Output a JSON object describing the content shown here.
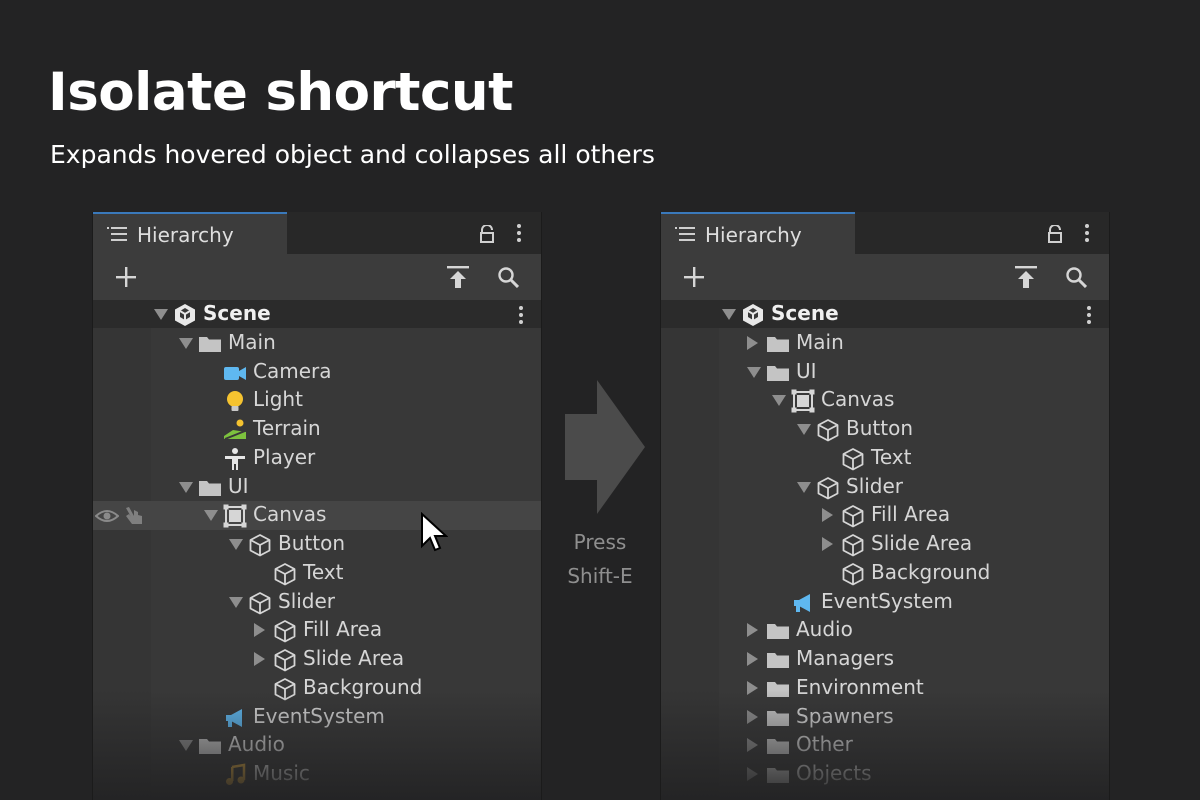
{
  "headline": "Isolate shortcut",
  "subline": "Expands hovered object and collapses all others",
  "arrow_text": {
    "line1": "Press",
    "line2": "Shift-E"
  },
  "panel_title": "Hierarchy",
  "colors": {
    "accent_tab": "#3a79bb",
    "folder": "#c4c4c4",
    "camera": "#5fb8f0",
    "light": "#f5c330",
    "terrain": "#7dc23e"
  },
  "left_tree": [
    {
      "label": "Scene",
      "depth": 0,
      "expander": "down",
      "icon": "unity-logo-icon",
      "bold": true
    },
    {
      "label": "Main",
      "depth": 1,
      "expander": "down",
      "icon": "folder-icon"
    },
    {
      "label": "Camera",
      "depth": 2,
      "expander": "none",
      "icon": "camera-icon"
    },
    {
      "label": "Light",
      "depth": 2,
      "expander": "none",
      "icon": "light-bulb-icon"
    },
    {
      "label": "Terrain",
      "depth": 2,
      "expander": "none",
      "icon": "terrain-icon"
    },
    {
      "label": "Player",
      "depth": 2,
      "expander": "none",
      "icon": "player-icon"
    },
    {
      "label": "UI",
      "depth": 1,
      "expander": "down",
      "icon": "folder-icon"
    },
    {
      "label": "Canvas",
      "depth": 2,
      "expander": "down",
      "icon": "canvas-icon",
      "hover": true
    },
    {
      "label": "Button",
      "depth": 3,
      "expander": "down",
      "icon": "cube-icon"
    },
    {
      "label": "Text",
      "depth": 4,
      "expander": "none",
      "icon": "cube-icon"
    },
    {
      "label": "Slider",
      "depth": 3,
      "expander": "down",
      "icon": "cube-icon"
    },
    {
      "label": "Fill Area",
      "depth": 4,
      "expander": "right",
      "icon": "cube-icon"
    },
    {
      "label": "Slide Area",
      "depth": 4,
      "expander": "right",
      "icon": "cube-icon"
    },
    {
      "label": "Background",
      "depth": 4,
      "expander": "none",
      "icon": "cube-icon"
    },
    {
      "label": "EventSystem",
      "depth": 2,
      "expander": "none",
      "icon": "megaphone-icon"
    },
    {
      "label": "Audio",
      "depth": 1,
      "expander": "down",
      "icon": "folder-icon"
    },
    {
      "label": "Music",
      "depth": 2,
      "expander": "none",
      "icon": "music-note-icon"
    }
  ],
  "right_tree": [
    {
      "label": "Scene",
      "depth": 0,
      "expander": "down",
      "icon": "unity-logo-icon",
      "bold": true
    },
    {
      "label": "Main",
      "depth": 1,
      "expander": "right",
      "icon": "folder-icon"
    },
    {
      "label": "UI",
      "depth": 1,
      "expander": "down",
      "icon": "folder-icon"
    },
    {
      "label": "Canvas",
      "depth": 2,
      "expander": "down",
      "icon": "canvas-icon"
    },
    {
      "label": "Button",
      "depth": 3,
      "expander": "down",
      "icon": "cube-icon"
    },
    {
      "label": "Text",
      "depth": 4,
      "expander": "none",
      "icon": "cube-icon"
    },
    {
      "label": "Slider",
      "depth": 3,
      "expander": "down",
      "icon": "cube-icon"
    },
    {
      "label": "Fill Area",
      "depth": 4,
      "expander": "right",
      "icon": "cube-icon"
    },
    {
      "label": "Slide Area",
      "depth": 4,
      "expander": "right",
      "icon": "cube-icon"
    },
    {
      "label": "Background",
      "depth": 4,
      "expander": "none",
      "icon": "cube-icon"
    },
    {
      "label": "EventSystem",
      "depth": 2,
      "expander": "none",
      "icon": "megaphone-icon"
    },
    {
      "label": "Audio",
      "depth": 1,
      "expander": "right",
      "icon": "folder-icon"
    },
    {
      "label": "Managers",
      "depth": 1,
      "expander": "right",
      "icon": "folder-icon"
    },
    {
      "label": "Environment",
      "depth": 1,
      "expander": "right",
      "icon": "folder-icon"
    },
    {
      "label": "Spawners",
      "depth": 1,
      "expander": "right",
      "icon": "folder-icon"
    },
    {
      "label": "Other",
      "depth": 1,
      "expander": "right",
      "icon": "folder-icon"
    },
    {
      "label": "Objects",
      "depth": 1,
      "expander": "right",
      "icon": "folder-icon"
    }
  ]
}
